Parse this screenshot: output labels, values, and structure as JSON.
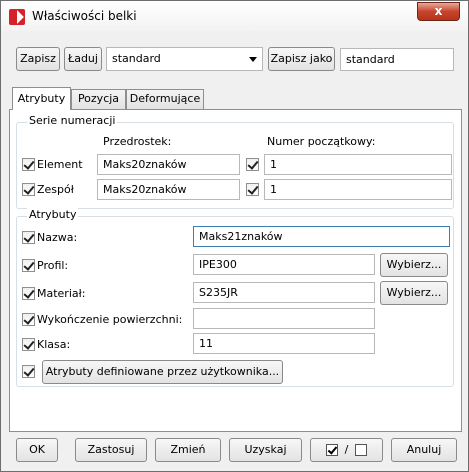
{
  "window": {
    "title": "Właściwości belki",
    "close_glyph": "x"
  },
  "top": {
    "save_label": "Zapisz",
    "load_label": "Ładuj",
    "preset_value": "standard",
    "save_as_label": "Zapisz jako",
    "save_as_value": "standard"
  },
  "tabs": [
    {
      "label": "Atrybuty",
      "active": true
    },
    {
      "label": "Pozycja",
      "active": false
    },
    {
      "label": "Deformujące",
      "active": false
    }
  ],
  "numbering": {
    "group_title": "Serie numeracji",
    "prefix_header": "Przedrostek:",
    "start_header": "Numer początkowy:",
    "rows": [
      {
        "label": "Element",
        "prefix": "Maks20znaków",
        "start": "1"
      },
      {
        "label": "Zespół",
        "prefix": "Maks20znaków",
        "start": "1"
      }
    ]
  },
  "attributes": {
    "group_title": "Atrybuty",
    "name_label": "Nazwa:",
    "name_value": "Maks21znaków",
    "profile_label": "Profil:",
    "profile_value": "IPE300",
    "profile_button": "Wybierz...",
    "material_label": "Materiał:",
    "material_value": "S235JR",
    "material_button": "Wybierz...",
    "finish_label": "Wykończenie powierzchni:",
    "finish_value": "",
    "class_label": "Klasa:",
    "class_value": "11",
    "udf_button": "Atrybuty definiowane przez użytkownika..."
  },
  "bottom": {
    "ok": "OK",
    "apply": "Zastosuj",
    "modify": "Zmień",
    "get": "Uzyskaj",
    "toggle_separator": "/",
    "cancel": "Anuluj"
  },
  "icons": [
    "app-icon",
    "close-icon",
    "dropdown-arrow-icon",
    "checkbox-checked-icon"
  ],
  "colors": {
    "close_button": "#c7442c",
    "active_field_border": "#3c7fb1"
  }
}
